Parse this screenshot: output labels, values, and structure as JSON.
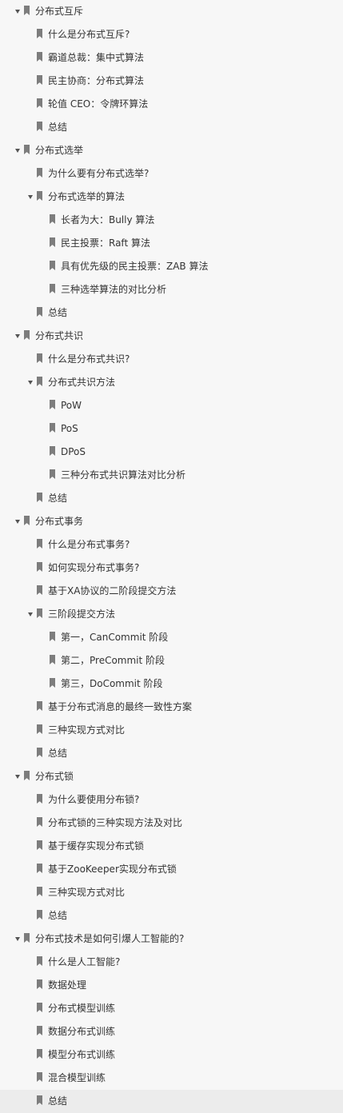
{
  "outline": [
    {
      "level": 0,
      "expanded": true,
      "label": "分布式互斥"
    },
    {
      "level": 1,
      "label": "什么是分布式互斥?"
    },
    {
      "level": 1,
      "label": "霸道总裁：集中式算法"
    },
    {
      "level": 1,
      "label": "民主协商：分布式算法"
    },
    {
      "level": 1,
      "label": "轮值 CEO：令牌环算法"
    },
    {
      "level": 1,
      "label": "总结"
    },
    {
      "level": 0,
      "expanded": true,
      "label": "分布式选举"
    },
    {
      "level": 1,
      "label": "为什么要有分布式选举?"
    },
    {
      "level": 1,
      "expanded": true,
      "label": "分布式选举的算法"
    },
    {
      "level": 2,
      "label": "长者为大：Bully 算法"
    },
    {
      "level": 2,
      "label": "民主投票：Raft 算法"
    },
    {
      "level": 2,
      "label": "具有优先级的民主投票：ZAB 算法"
    },
    {
      "level": 2,
      "label": "三种选举算法的对比分析"
    },
    {
      "level": 1,
      "label": "总结"
    },
    {
      "level": 0,
      "expanded": true,
      "label": "分布式共识"
    },
    {
      "level": 1,
      "label": "什么是分布式共识?"
    },
    {
      "level": 1,
      "expanded": true,
      "label": "分布式共识方法"
    },
    {
      "level": 2,
      "label": "PoW"
    },
    {
      "level": 2,
      "label": "PoS"
    },
    {
      "level": 2,
      "label": "DPoS"
    },
    {
      "level": 2,
      "label": "三种分布式共识算法对比分析"
    },
    {
      "level": 1,
      "label": "总结"
    },
    {
      "level": 0,
      "expanded": true,
      "label": "分布式事务"
    },
    {
      "level": 1,
      "label": "什么是分布式事务?"
    },
    {
      "level": 1,
      "label": "如何实现分布式事务?"
    },
    {
      "level": 1,
      "label": "基于XA协议的二阶段提交方法"
    },
    {
      "level": 1,
      "expanded": true,
      "label": "三阶段提交方法"
    },
    {
      "level": 2,
      "label": "第一，CanCommit 阶段"
    },
    {
      "level": 2,
      "label": "第二，PreCommit 阶段"
    },
    {
      "level": 2,
      "label": "第三，DoCommit 阶段"
    },
    {
      "level": 1,
      "label": "基于分布式消息的最终一致性方案"
    },
    {
      "level": 1,
      "label": "三种实现方式对比"
    },
    {
      "level": 1,
      "label": "总结"
    },
    {
      "level": 0,
      "expanded": true,
      "label": "分布式锁"
    },
    {
      "level": 1,
      "label": "为什么要使用分布锁?"
    },
    {
      "level": 1,
      "label": "分布式锁的三种实现方法及对比"
    },
    {
      "level": 1,
      "label": "基于缓存实现分布式锁"
    },
    {
      "level": 1,
      "label": "基于ZooKeeper实现分布式锁"
    },
    {
      "level": 1,
      "label": "三种实现方式对比"
    },
    {
      "level": 1,
      "label": "总结"
    },
    {
      "level": 0,
      "expanded": true,
      "label": "分布式技术是如何引爆人工智能的?"
    },
    {
      "level": 1,
      "label": "什么是人工智能?"
    },
    {
      "level": 1,
      "label": "数据处理"
    },
    {
      "level": 1,
      "label": "分布式模型训练"
    },
    {
      "level": 1,
      "label": "数据分布式训练"
    },
    {
      "level": 1,
      "label": "模型分布式训练"
    },
    {
      "level": 1,
      "label": "混合模型训练"
    },
    {
      "level": 1,
      "label": "总结",
      "highlighted": true
    }
  ],
  "colors": {
    "background": "#f7f7f7",
    "text": "#333333",
    "bookmark": "#7d7d7d",
    "caret": "#555555",
    "highlight": "#ececec"
  }
}
